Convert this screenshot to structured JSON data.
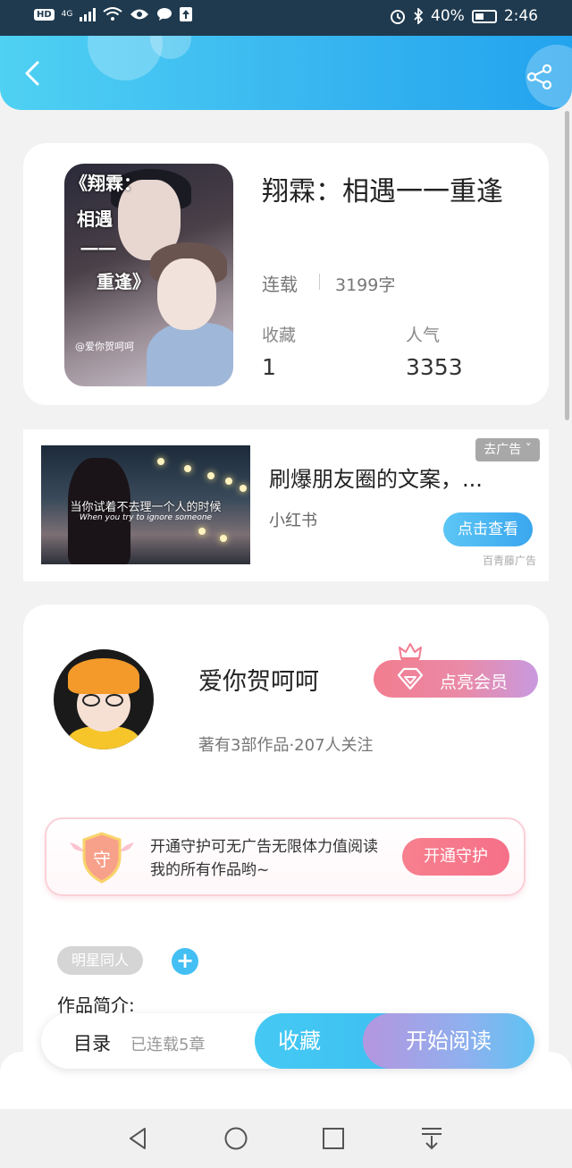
{
  "status_bar": {
    "network": "4G",
    "hd": "HD",
    "battery": "40%",
    "time": "2:46"
  },
  "header": {
    "back_icon": "chevron-left-icon",
    "share_icon": "share-icon",
    "gradient": [
      "#4fd1f3",
      "#22a3ee"
    ]
  },
  "book": {
    "title": "翔霖：相遇一一重逢",
    "status": "连载",
    "word_count": "3199字",
    "favorites_label": "收藏",
    "favorites_value": "1",
    "popularity_label": "人气",
    "popularity_value": "3353",
    "cover_text": [
      "《翔霖：",
      "相遇",
      "一一",
      "重逢》"
    ],
    "cover_signature": "@爱你贺呵呵"
  },
  "ad": {
    "title": "刷爆朋友圈的文案，...",
    "source": "小红书",
    "close_label": "去广告 ˇ",
    "action_label": "点击查看",
    "provider": "百青藤广告",
    "image_caption": "当你试着不去理一个人的时候",
    "image_caption_en": "When you try to ignore someone"
  },
  "author": {
    "name": "爱你贺呵呵",
    "meta": "著有3部作品·207人关注",
    "vip_label": "点亮会员",
    "guard_text": "开通守护可无广告无限体力值阅读我的所有作品哟~",
    "guard_badge": "守",
    "guard_button": "开通守护",
    "tag": "明星同人",
    "intro_label": "作品简介:"
  },
  "action_bar": {
    "toc_label": "目录",
    "toc_sub": "已连载5章",
    "favorite_label": "收藏",
    "read_label": "开始阅读"
  },
  "nav": {
    "icons": [
      "back-triangle-icon",
      "home-circle-icon",
      "recents-square-icon",
      "notification-pull-icon"
    ]
  },
  "colors": {
    "accent": "#3dc0f2",
    "vip": "#f27d8f",
    "guard": "#f57088",
    "background": "#f2f2f2"
  }
}
